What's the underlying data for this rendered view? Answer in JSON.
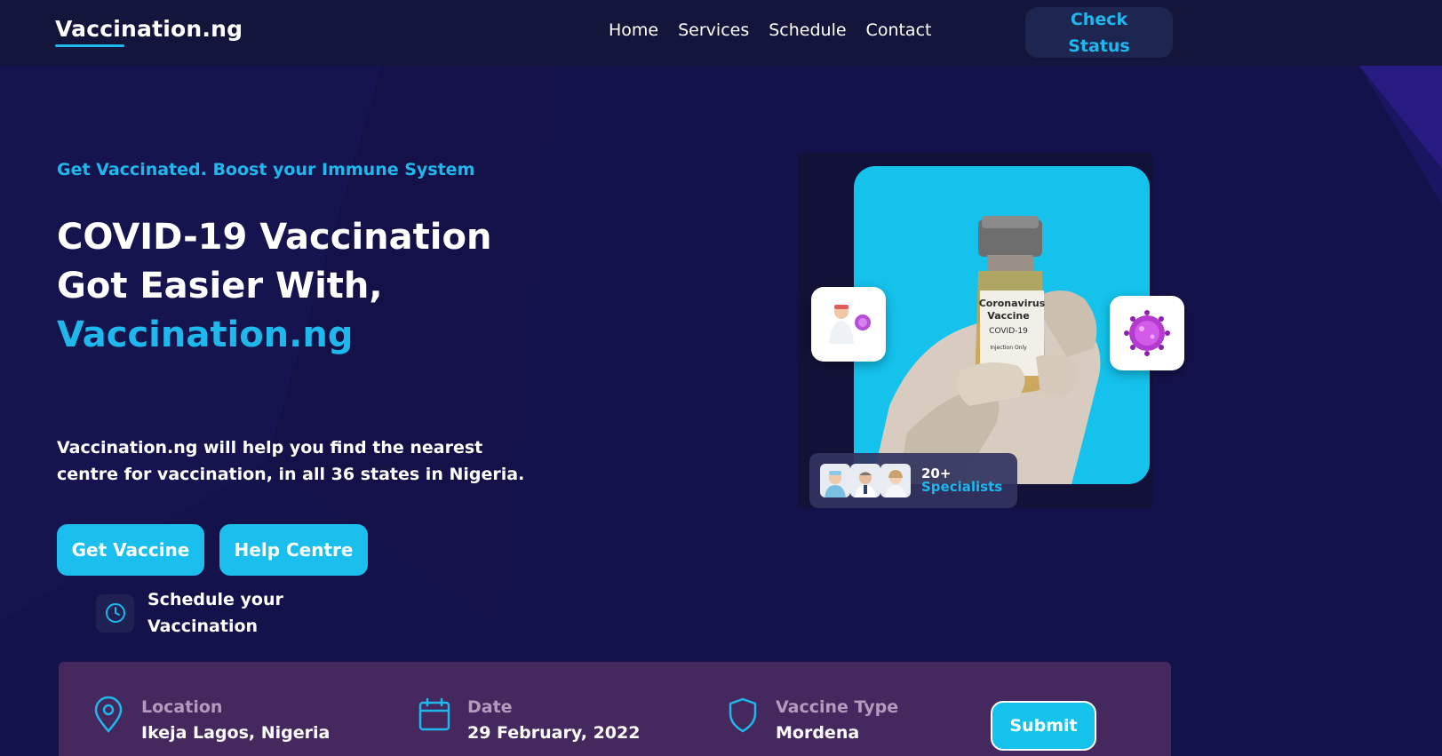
{
  "brand": {
    "name": "Vaccination.ng"
  },
  "nav": {
    "links": [
      "Home",
      "Services",
      "Schedule",
      "Contact"
    ],
    "cta": "Check Status"
  },
  "hero": {
    "tagline": "Get Vaccinated. Boost your Immune System",
    "headline_line1": "COVID-19 Vaccination",
    "headline_line2": "Got Easier With,",
    "headline_accent": "Vaccination.ng",
    "description": "Vaccination.ng will help you find the nearest centre for vaccination, in all 36 states in Nigeria.",
    "buttons": {
      "primary": "Get Vaccine",
      "secondary": "Help Centre"
    },
    "schedule_text": "Schedule your Vaccination"
  },
  "vial": {
    "line1": "Coronavirus",
    "line2": "Vaccine",
    "line3": "COVID-19",
    "line4": "Injection Only"
  },
  "specialists": {
    "count": "20+",
    "label": "Specialists"
  },
  "booking": {
    "location": {
      "label": "Location",
      "value": "Ikeja Lagos, Nigeria"
    },
    "date": {
      "label": "Date",
      "value": "29 February, 2022"
    },
    "vaccine_type": {
      "label": "Vaccine Type",
      "value": "Mordena"
    },
    "submit": "Submit"
  },
  "colors": {
    "background": "#14124a",
    "navbar": "#13163a",
    "accent": "#1fb8ec",
    "booking_bar": "#45295e"
  }
}
